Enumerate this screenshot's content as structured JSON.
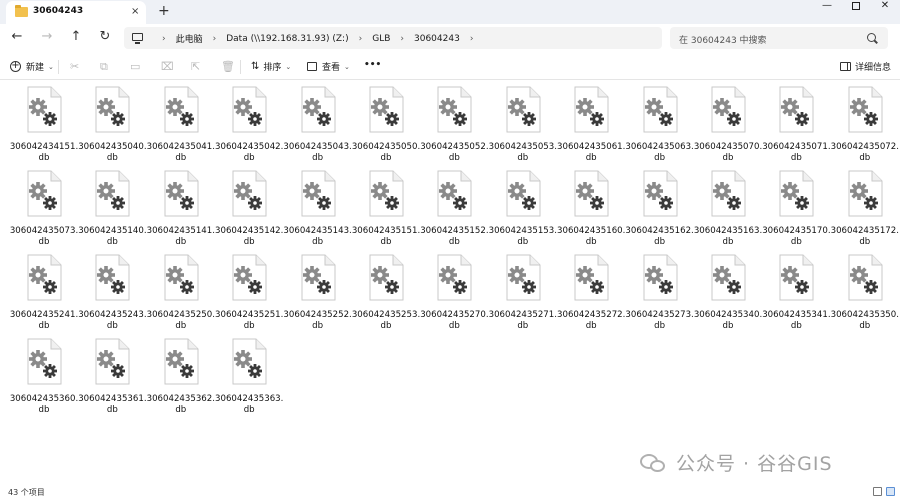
{
  "window": {
    "tab_title": "30604243",
    "tab_close": "×",
    "new_tab": "+",
    "minimize": "—",
    "close": "✕"
  },
  "nav": {
    "back": "←",
    "forward": "→",
    "up": "↑",
    "refresh": "↻"
  },
  "breadcrumb": [
    "此电脑",
    "Data (\\\\192.168.31.93) (Z:)",
    "GLB",
    "30604243"
  ],
  "breadcrumb_separator": "›",
  "search": {
    "placeholder": "在 30604243 中搜索"
  },
  "toolbar": {
    "new_label": "新建",
    "sort_label": "排序",
    "view_label": "查看",
    "more_label": "•••",
    "details_label": "详细信息"
  },
  "files": [
    "306042434151.db",
    "306042435040.db",
    "306042435041.db",
    "306042435042.db",
    "306042435043.db",
    "306042435050.db",
    "306042435052.db",
    "306042435053.db",
    "306042435061.db",
    "306042435063.db",
    "306042435070.db",
    "306042435071.db",
    "306042435072.db",
    "306042435073.db",
    "306042435140.db",
    "306042435141.db",
    "306042435142.db",
    "306042435143.db",
    "306042435151.db",
    "306042435152.db",
    "306042435153.db",
    "306042435160.db",
    "306042435162.db",
    "306042435163.db",
    "306042435170.db",
    "306042435172.db",
    "306042435241.db",
    "306042435243.db",
    "306042435250.db",
    "306042435251.db",
    "306042435252.db",
    "306042435253.db",
    "306042435270.db",
    "306042435271.db",
    "306042435272.db",
    "306042435273.db",
    "306042435340.db",
    "306042435341.db",
    "306042435350.db",
    "306042435360.db",
    "306042435361.db",
    "306042435362.db",
    "306042435363.db"
  ],
  "file_icon": "settings-file-icon",
  "status": {
    "count_text": "43 个项目"
  },
  "watermark": {
    "text": "公众号 · 谷谷GIS",
    "icon": "wechat-icon"
  }
}
